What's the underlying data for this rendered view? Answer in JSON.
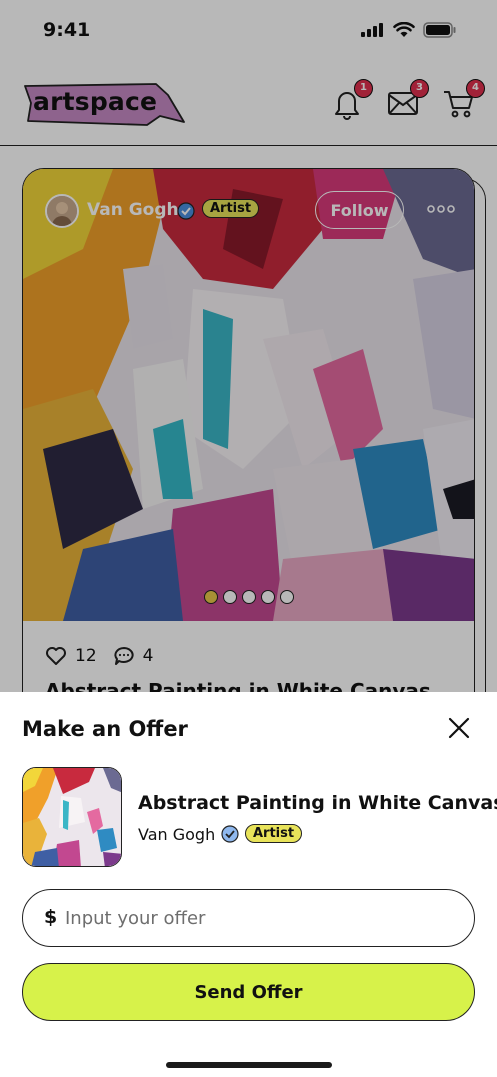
{
  "status_bar": {
    "time": "9:41"
  },
  "header": {
    "logo_text": "artspace",
    "notifications_count": "1",
    "messages_count": "3",
    "cart_count": "4"
  },
  "post": {
    "artist_name": "Van Gogh",
    "artist_badge": "Artist",
    "follow_label": "Follow",
    "likes": "12",
    "comments": "4",
    "title": "Abstract Painting in White Canvas",
    "carousel_total": 5,
    "carousel_active": 0
  },
  "offer_sheet": {
    "title": "Make an Offer",
    "artwork_title": "Abstract Painting in White Canvas",
    "artist_name": "Van Gogh",
    "artist_badge": "Artist",
    "currency_symbol": "$",
    "input_placeholder": "Input your offer",
    "input_value": "",
    "send_label": "Send Offer"
  },
  "colors": {
    "accent_lime": "#d7f24a",
    "badge_yellow": "#e8e35a",
    "notification_red": "#e0304e",
    "logo_pink": "#c58ac4",
    "verified_blue": "#4a8fe0"
  }
}
